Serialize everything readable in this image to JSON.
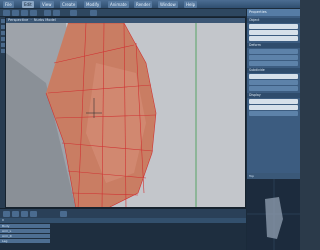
{
  "menubar": {
    "items": [
      "File",
      "Edit",
      "View",
      "Create",
      "Modify",
      "Animate",
      "Render",
      "Window",
      "Help"
    ],
    "active_index": 1
  },
  "viewport": {
    "title": "Perspective",
    "label": "Nurbs Model"
  },
  "right_panel": {
    "header": "Properties",
    "sections": [
      "Object",
      "Deform",
      "Subdivide",
      "Display"
    ],
    "fields_count": 6
  },
  "mini_viewport": {
    "title": "Top"
  },
  "timeline": {
    "ruler_label": "0",
    "tracks": [
      "Body",
      "Arm_L",
      "Arm_R",
      "Leg"
    ]
  },
  "colors": {
    "accent": "#4f7aa6",
    "mesh_fill": "#c97d63",
    "wire": "#d03232",
    "background": "#c5c8cc"
  }
}
